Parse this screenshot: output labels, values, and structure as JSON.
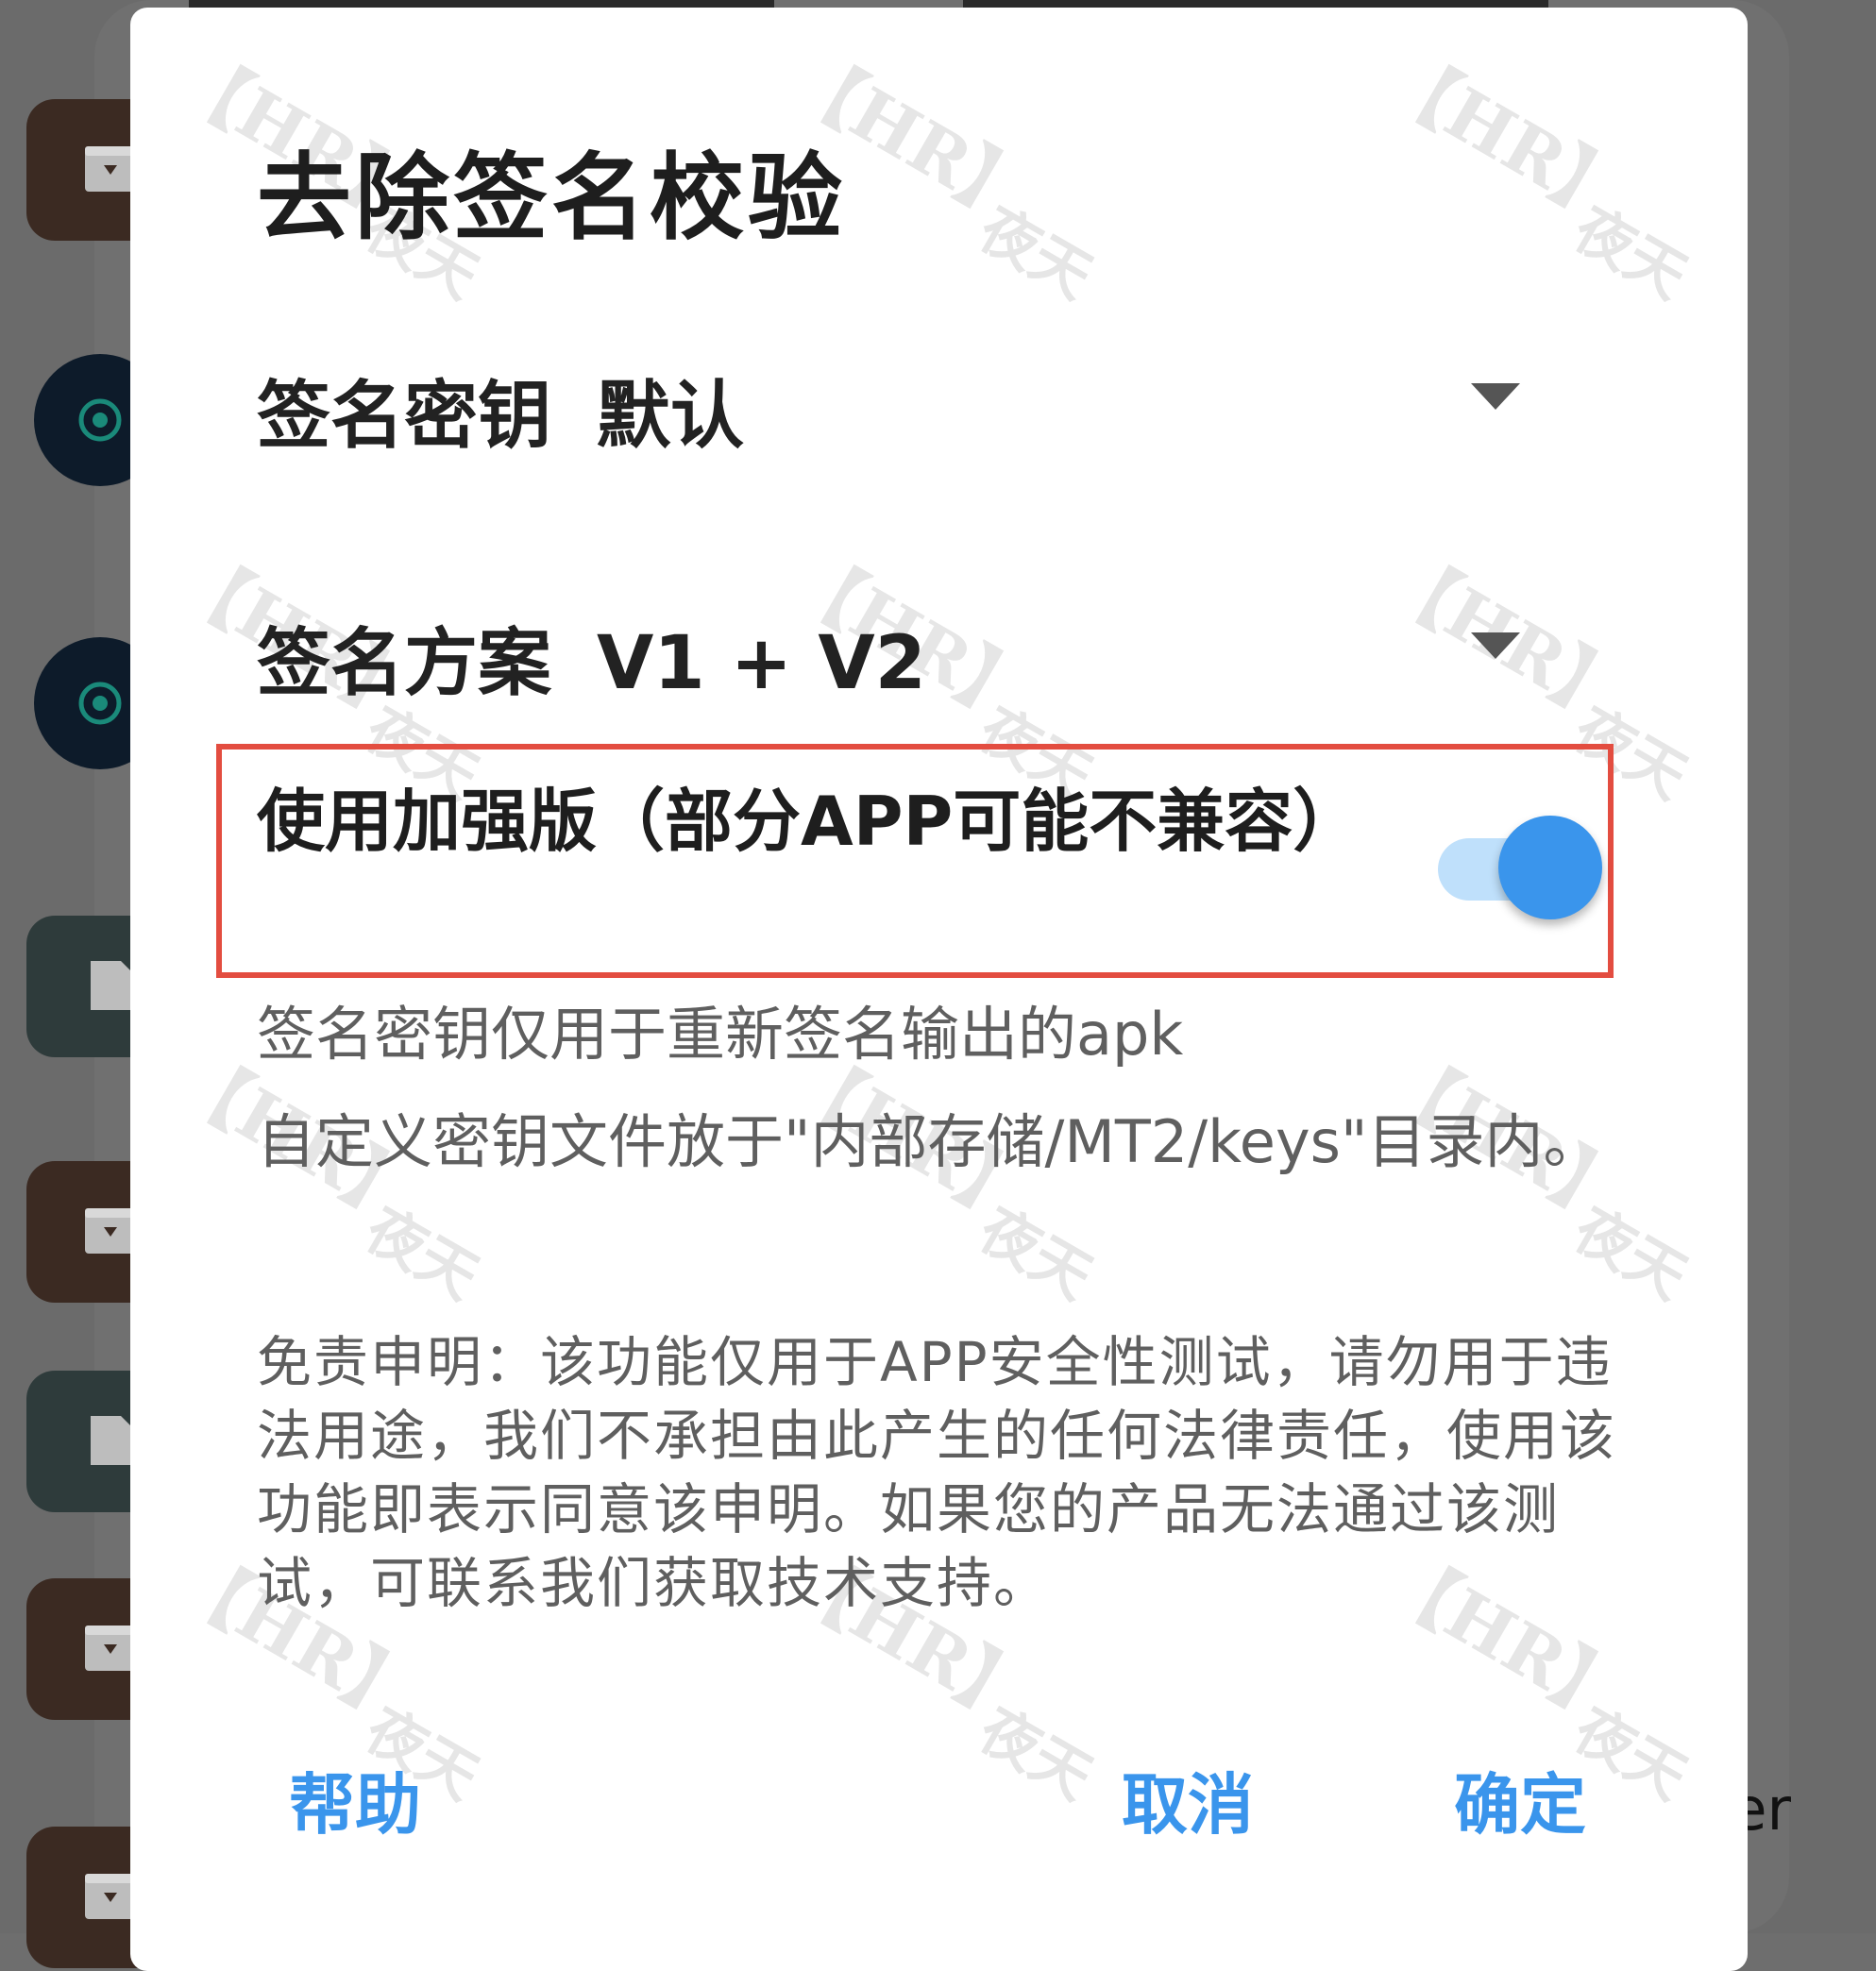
{
  "dialog": {
    "title": "去除签名校验",
    "signing_key": {
      "label": "签名密钥",
      "value": "默认"
    },
    "signing_scheme": {
      "label": "签名方案",
      "value": "V1 + V2"
    },
    "enhanced": {
      "label": "使用加强版（部分APP可能不兼容）",
      "enabled": true
    },
    "info_line1": "签名密钥仅用于重新签名输出的apk",
    "info_line2": "自定义密钥文件放于\"内部存储/MT2/keys\"目录内。",
    "disclaimer": "免责申明：该功能仅用于APP安全性测试，请勿用于违法用途，我们不承担由此产生的任何法律责任，使用该功能即表示同意该申明。如果您的产品无法通过该测试，可联系我们获取技术支持。",
    "buttons": {
      "help": "帮助",
      "cancel": "取消",
      "confirm": "确定"
    }
  },
  "watermark": {
    "mark": "【HR】",
    "signature": "夜天"
  },
  "background": {
    "partial_text": "er"
  },
  "colors": {
    "accent": "#3a95ec",
    "toggle_track": "#bfe0fb",
    "highlight_border": "#e34d40"
  },
  "icons": {
    "dropdown": "triangle-down-icon",
    "file": "file-icon",
    "archive": "archive-icon"
  }
}
